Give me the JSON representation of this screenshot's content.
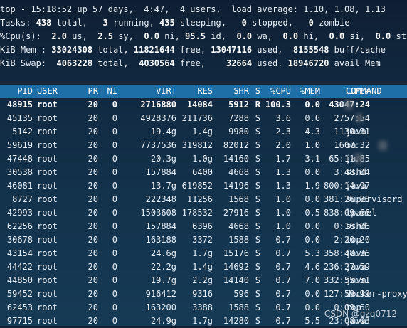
{
  "summary": {
    "line1": "top - 15:18:52 up 57 days,  4:47,  4 users,  load average: 1.10, 1.08, 1.13",
    "tasks": {
      "label": "Tasks:",
      "total": "438",
      "total_t": " total,",
      "running": "3",
      "running_t": " running,",
      "sleeping": "435",
      "sleeping_t": " sleeping,",
      "stopped": "0",
      "stopped_t": " stopped,",
      "zombie": "0",
      "zombie_t": " zombie"
    },
    "cpu": {
      "label": "%Cpu(s):",
      "us": "2.0",
      "us_t": " us,",
      "sy": "2.5",
      "sy_t": " sy,",
      "ni": "0.0",
      "ni_t": " ni,",
      "id": "95.5",
      "id_t": " id,",
      "wa": "0.0",
      "wa_t": " wa,",
      "hi": "0.0",
      "hi_t": " hi,",
      "si": "0.0",
      "si_t": " si,",
      "st": "0.0",
      "st_t": " st"
    },
    "mem": {
      "label": "KiB Mem :",
      "total": "33024308",
      "total_t": " total,",
      "free": "11821644",
      "free_t": " free,",
      "used": "13047116",
      "used_t": " used,",
      "buff": "8155548",
      "buff_t": " buff/cache"
    },
    "swap": {
      "label": "KiB Swap:",
      "total": "4063228",
      "total_t": " total,",
      "free": "4030564",
      "free_t": " free,",
      "used": "32664",
      "used_t": " used.",
      "avail": "18946720",
      "avail_t": " avail Mem"
    }
  },
  "columns": [
    "PID",
    "USER",
    "PR",
    "NI",
    "VIRT",
    "RES",
    "SHR",
    "S",
    "%CPU",
    "%MEM",
    "TIME+",
    "COMMAND"
  ],
  "processes": [
    {
      "pid": "48915",
      "user": "root",
      "pr": "20",
      "ni": "0",
      "virt": "2716880",
      "res": "14084",
      "shr": "5912",
      "s": "R",
      "cpu": "100.3",
      "mem": "0.0",
      "time": "43047:24",
      "cmd": ""
    },
    {
      "pid": "45135",
      "user": "root",
      "pr": "20",
      "ni": "0",
      "virt": "4928376",
      "res": "211736",
      "shr": "7288",
      "s": "S",
      "cpu": "3.6",
      "mem": "0.6",
      "time": "2757:54",
      "cmd": ""
    },
    {
      "pid": "5142",
      "user": "root",
      "pr": "20",
      "ni": "0",
      "virt": "19.4g",
      "res": "1.4g",
      "shr": "9980",
      "s": "S",
      "cpu": "2.3",
      "mem": "4.3",
      "time": "1130:31",
      "cmd": "java"
    },
    {
      "pid": "59619",
      "user": "root",
      "pr": "20",
      "ni": "0",
      "virt": "7737536",
      "res": "319812",
      "shr": "82012",
      "s": "S",
      "cpu": "2.0",
      "mem": "1.0",
      "time": "1667:32",
      "cmd": "ba"
    },
    {
      "pid": "47448",
      "user": "root",
      "pr": "20",
      "ni": "0",
      "virt": "20.3g",
      "res": "1.0g",
      "shr": "14160",
      "s": "S",
      "cpu": "1.7",
      "mem": "3.1",
      "time": "65:11.85",
      "cmd": "ja"
    },
    {
      "pid": "30538",
      "user": "root",
      "pr": "20",
      "ni": "0",
      "virt": "157884",
      "res": "6400",
      "shr": "4668",
      "s": "S",
      "cpu": "1.3",
      "mem": "0.0",
      "time": "3:48.04",
      "cmd": "sshd"
    },
    {
      "pid": "46081",
      "user": "root",
      "pr": "20",
      "ni": "0",
      "virt": "13.7g",
      "res": "619852",
      "shr": "14196",
      "s": "S",
      "cpu": "1.3",
      "mem": "1.9",
      "time": "800:14.97",
      "cmd": "java"
    },
    {
      "pid": "8727",
      "user": "root",
      "pr": "20",
      "ni": "0",
      "virt": "222348",
      "res": "11256",
      "shr": "1568",
      "s": "S",
      "cpu": "1.0",
      "mem": "0.0",
      "time": "381:26.88",
      "cmd": "supervisord"
    },
    {
      "pid": "42993",
      "user": "root",
      "pr": "20",
      "ni": "0",
      "virt": "1503608",
      "res": "178532",
      "shr": "27916",
      "s": "S",
      "cpu": "1.0",
      "mem": "0.5",
      "time": "838:09.66",
      "cmd": "lpanel"
    },
    {
      "pid": "62256",
      "user": "root",
      "pr": "20",
      "ni": "0",
      "virt": "157884",
      "res": "6396",
      "shr": "4668",
      "s": "S",
      "cpu": "1.0",
      "mem": "0.0",
      "time": "0:16.06",
      "cmd": "sshd"
    },
    {
      "pid": "30678",
      "user": "root",
      "pr": "20",
      "ni": "0",
      "virt": "163188",
      "res": "3372",
      "shr": "1588",
      "s": "S",
      "cpu": "0.7",
      "mem": "0.0",
      "time": "2:20.20",
      "cmd": "top"
    },
    {
      "pid": "43154",
      "user": "root",
      "pr": "20",
      "ni": "0",
      "virt": "24.6g",
      "res": "1.7g",
      "shr": "15176",
      "s": "S",
      "cpu": "0.7",
      "mem": "5.3",
      "time": "358:48.36",
      "cmd": "java"
    },
    {
      "pid": "44422",
      "user": "root",
      "pr": "20",
      "ni": "0",
      "virt": "22.2g",
      "res": "1.4g",
      "shr": "14692",
      "s": "S",
      "cpu": "0.7",
      "mem": "4.6",
      "time": "236:27.59",
      "cmd": "java"
    },
    {
      "pid": "44850",
      "user": "root",
      "pr": "20",
      "ni": "0",
      "virt": "19.7g",
      "res": "2.2g",
      "shr": "14140",
      "s": "S",
      "cpu": "0.7",
      "mem": "7.0",
      "time": "332:55.51",
      "cmd": "java"
    },
    {
      "pid": "59452",
      "user": "root",
      "pr": "20",
      "ni": "0",
      "virt": "916412",
      "res": "9316",
      "shr": "596",
      "s": "S",
      "cpu": "0.7",
      "mem": "0.0",
      "time": "127:59.99",
      "cmd": "docker-proxy"
    },
    {
      "pid": "62453",
      "user": "root",
      "pr": "20",
      "ni": "0",
      "virt": "163200",
      "res": "3388",
      "shr": "1588",
      "s": "S",
      "cpu": "0.7",
      "mem": "0.0",
      "time": "0:09.60",
      "cmd": "top"
    },
    {
      "pid": "97715",
      "user": "root",
      "pr": "20",
      "ni": "0",
      "virt": "24.9g",
      "res": "1.7g",
      "shr": "14280",
      "s": "S",
      "cpu": "0.7",
      "mem": "5.5",
      "time": "23:08.03",
      "cmd": "java"
    }
  ],
  "watermark": "CSDN @gzq0712"
}
